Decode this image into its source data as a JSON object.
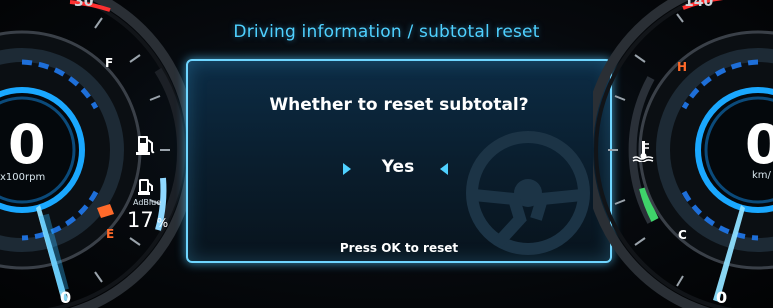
{
  "header": {
    "title": "Driving information / subtotal reset"
  },
  "dialog": {
    "question": "Whether to reset subtotal?",
    "option": "Yes",
    "hint": "Press OK to reset"
  },
  "left_gauge": {
    "rpm_value": "0",
    "rpm_unit": "x100rpm",
    "scale_top": "30",
    "scale_bottom": "0",
    "fuel_full": "F",
    "fuel_empty": "E",
    "adblue_label": "AdBlue",
    "adblue_level": "17",
    "adblue_unit": "%",
    "icons": [
      "fuel-pump-icon",
      "adblue-pump-icon"
    ]
  },
  "right_gauge": {
    "speed_value": "0",
    "speed_unit": "km/",
    "scale_top": "140",
    "scale_bottom": "0",
    "temp_hot": "H",
    "temp_cold": "C",
    "icons": [
      "coolant-temperature-icon"
    ]
  },
  "colors": {
    "accent": "#4fd1ff",
    "warning": "#ff6a2a",
    "normal": "#3fd46a",
    "danger": "#ff3030"
  }
}
